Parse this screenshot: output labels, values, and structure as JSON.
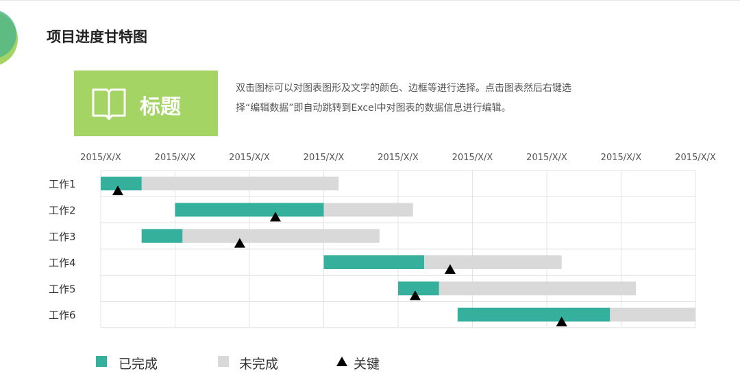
{
  "page": {
    "title": "项目进度甘特图"
  },
  "title_box": {
    "label": "标题",
    "icon": "open-book-icon"
  },
  "description": {
    "line1": "双击图标可以对图表图形及文字的颜色、边框等进行选择。点击图表然后右键选",
    "line2": "择“编辑数据”即自动跳转到Excel中对图表的数据信息进行编辑。"
  },
  "colors": {
    "done": "#35b09c",
    "todo": "#d9d9d9",
    "milestone": "#000000",
    "accent_green": "#a4d464",
    "deco_green": "#52b788"
  },
  "chart_data": {
    "type": "bar",
    "orientation": "horizontal-stacked-gantt",
    "x_ticks": [
      "2015/X/X",
      "2015/X/X",
      "2015/X/X",
      "2015/X/X",
      "2015/X/X",
      "2015/X/X",
      "2015/X/X",
      "2015/X/X",
      "2015/X/X"
    ],
    "xlim": [
      0,
      8
    ],
    "grid": true,
    "legend_position": "bottom",
    "categories": [
      "工作1",
      "工作2",
      "工作3",
      "工作4",
      "工作5",
      "工作6"
    ],
    "series": [
      {
        "name": "已完成",
        "start": [
          0,
          1,
          0.55,
          3,
          4,
          4.8
        ],
        "duration": [
          0.55,
          2,
          0.55,
          1.35,
          0.55,
          2.05
        ]
      },
      {
        "name": "未完成",
        "duration": [
          2.65,
          1.2,
          2.65,
          1.85,
          2.65,
          1.15
        ]
      },
      {
        "name": "关键",
        "values": [
          0.23,
          2.35,
          1.87,
          4.7,
          4.23,
          6.2
        ]
      }
    ]
  }
}
